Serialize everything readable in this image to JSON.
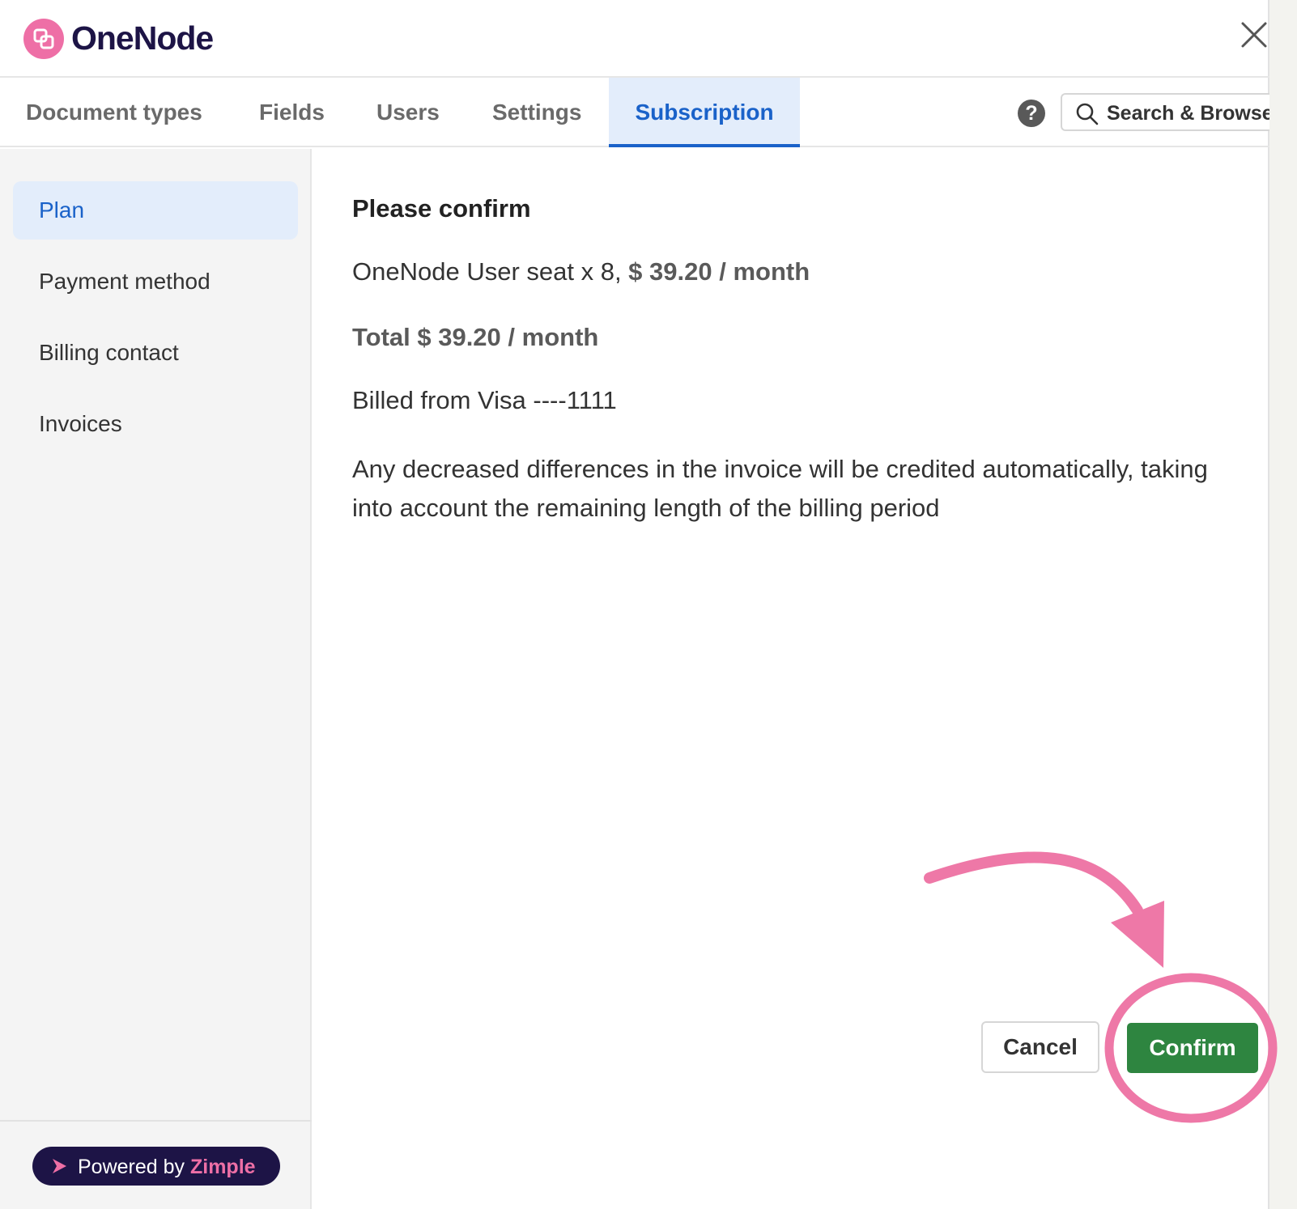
{
  "app": {
    "name": "OneNode",
    "brand_color": "#ee6fa6"
  },
  "tabs": [
    {
      "label": "Document types",
      "active": false
    },
    {
      "label": "Fields",
      "active": false
    },
    {
      "label": "Users",
      "active": false
    },
    {
      "label": "Settings",
      "active": false
    },
    {
      "label": "Subscription",
      "active": true
    }
  ],
  "toolbar": {
    "help_icon": "?",
    "search_label": "Search & Browse"
  },
  "sidebar": {
    "items": [
      {
        "label": "Plan",
        "active": true
      },
      {
        "label": "Payment method",
        "active": false
      },
      {
        "label": "Billing contact",
        "active": false
      },
      {
        "label": "Invoices",
        "active": false
      }
    ],
    "powered_by": {
      "prefix": "Powered by",
      "brand": "Zimple"
    }
  },
  "confirm": {
    "heading": "Please confirm",
    "seat_line_prefix": "OneNode User seat x 8, ",
    "seat_line_price": "$ 39.20 / month",
    "total": "Total $ 39.20 / month",
    "billed_from": "Billed from Visa ----1111",
    "note": "Any decreased differences in the invoice will be credited automatically, taking into account the remaining length of the billing period"
  },
  "actions": {
    "cancel_label": "Cancel",
    "confirm_label": "Confirm",
    "confirm_color": "#2e8540"
  },
  "annotation": {
    "color": "#ee6fa6",
    "type": "arrow-and-circle"
  }
}
